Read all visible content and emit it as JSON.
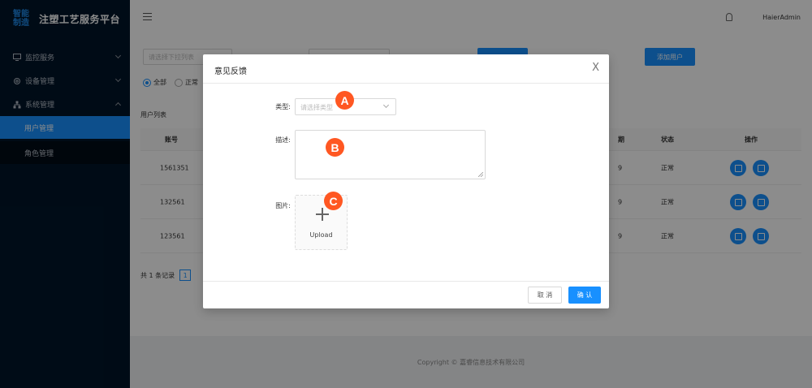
{
  "sidebar": {
    "logo_mark": "智能制造",
    "logo_title": "注塑工艺服务平台",
    "menus": [
      {
        "label": "监控服务",
        "icon": "monitor-icon",
        "expanded": false
      },
      {
        "label": "设备管理",
        "icon": "gear-icon",
        "expanded": false
      },
      {
        "label": "系统管理",
        "icon": "org-icon",
        "expanded": true
      }
    ],
    "sub_items": [
      {
        "label": "用户管理",
        "active": true
      },
      {
        "label": "角色管理",
        "active": false
      }
    ]
  },
  "header": {
    "username": "HaierAdmin"
  },
  "main": {
    "filter_placeholder": "请选择下拉列表",
    "add_user_label": "添加用户",
    "radio_all": "全部",
    "radio_normal": "正常",
    "list_title": "用户列表",
    "columns": {
      "account": "账号",
      "date_partial": "期",
      "status": "状态",
      "action": "操作"
    },
    "rows": [
      {
        "account": "1561351",
        "date_partial": "9",
        "status": "正常"
      },
      {
        "account": "132561",
        "date_partial": "9",
        "status": "正常"
      },
      {
        "account": "123561",
        "date_partial": "9",
        "status": "正常"
      }
    ],
    "pager_total": "共 1 条记录",
    "pager_page": "1"
  },
  "footer": {
    "copyright": "Copyright © 嘉睿信息技术有限公司"
  },
  "modal": {
    "title": "意见反馈",
    "close_glyph": "X",
    "type_label": "类型:",
    "type_placeholder": "请选择类型",
    "desc_label": "描述:",
    "image_label": "图片:",
    "upload_text": "Upload",
    "cancel_label": "取 消",
    "ok_label": "确 认"
  },
  "markers": {
    "a": "A",
    "b": "B",
    "c": "C"
  },
  "colors": {
    "primary": "#1890ff",
    "sidebar_bg": "#001529",
    "marker": "#ff5722"
  }
}
